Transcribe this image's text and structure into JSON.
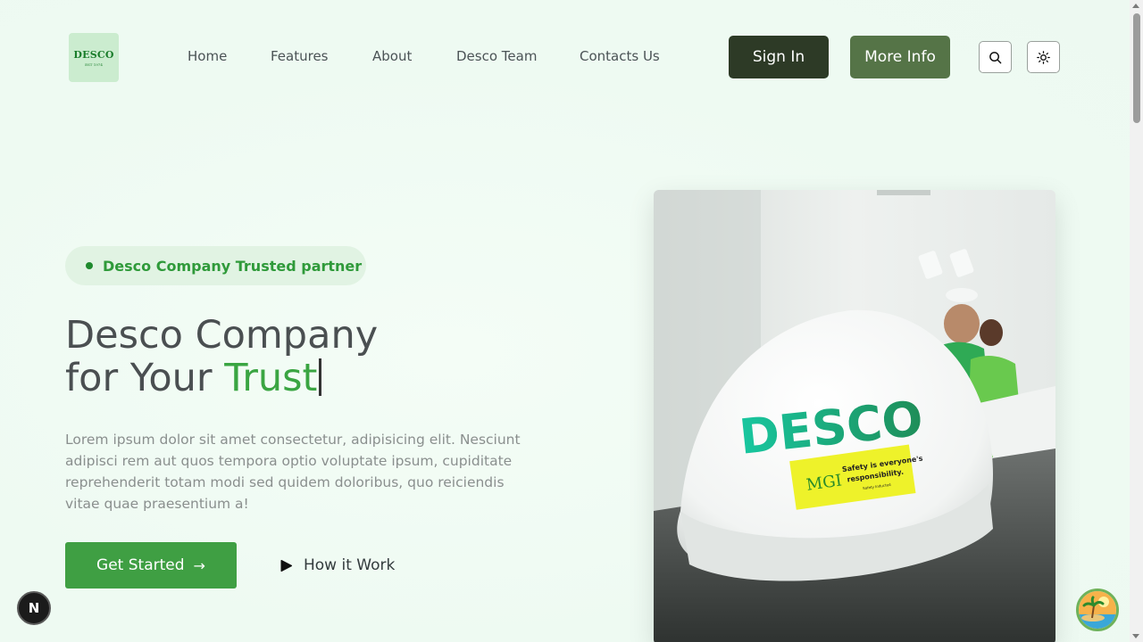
{
  "brand": {
    "logo_text": "DESCO",
    "logo_est": "EST 1974"
  },
  "nav": {
    "items": [
      {
        "label": "Home"
      },
      {
        "label": "Features"
      },
      {
        "label": "About"
      },
      {
        "label": "Desco Team"
      },
      {
        "label": "Contacts Us"
      }
    ]
  },
  "header": {
    "signin_label": "Sign In",
    "more_info_label": "More Info",
    "search_icon": "search-icon",
    "theme_icon": "sun-icon"
  },
  "hero": {
    "badge_text": "Desco Company Trusted partner",
    "headline_line1": "Desco Company",
    "headline_line2_prefix": "for Your ",
    "headline_accent": "Trust",
    "description": "Lorem ipsum dolor sit amet consectetur, adipisicing elit. Nesciunt adipisci rem aut quos tempora optio voluptate ipsum, cupiditate reprehenderit totam modi sed quidem doloribus, quo reiciendis vitae quae praesentium a!",
    "get_started_label": "Get Started",
    "how_it_work_label": "How it Work",
    "image": {
      "helmet_text": "DESCO",
      "sticker_brand": "MGI",
      "sticker_line1": "Safety is everyone's",
      "sticker_line2": "responsibility.",
      "sticker_line3": "Safety Inducted"
    }
  },
  "widgets": {
    "next_badge": "N"
  },
  "colors": {
    "accent": "#3aa542",
    "signin_bg": "#2d3a26",
    "more_info_bg": "#557447",
    "background": "#f1fbf4"
  }
}
